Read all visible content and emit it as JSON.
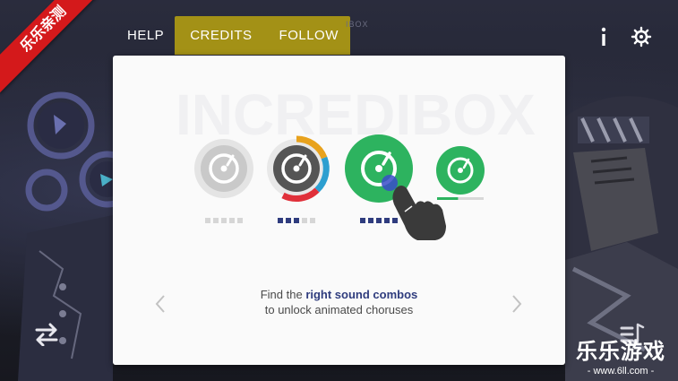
{
  "nav": {
    "help": "HELP",
    "credits": "CREDITS",
    "follow": "FOLLOW",
    "ghost": "IBOX"
  },
  "icons": {
    "info": "info-icon",
    "settings": "gear-icon",
    "swap": "swap-icon",
    "list": "music-list-icon",
    "prev": "chevron-left-icon",
    "next": "chevron-right-icon",
    "hand": "pointing-hand-icon"
  },
  "tutorial": {
    "line1_prefix": "Find the ",
    "line1_bold": "right sound combos",
    "line2": "to unlock animated choruses",
    "step_dots": [
      {
        "filled": 0,
        "total": 5
      },
      {
        "filled": 3,
        "total": 5
      },
      {
        "filled": 5,
        "total": 5
      }
    ],
    "unlock_progress": 0.45
  },
  "watermark": {
    "title": "乐乐游戏",
    "url": "- www.6ll.com -",
    "ribbon": "乐乐亲测"
  },
  "colors": {
    "accent": "#a39116",
    "green": "#2db35f",
    "navy": "#2f3c7e",
    "ribbon": "#d4191b"
  }
}
